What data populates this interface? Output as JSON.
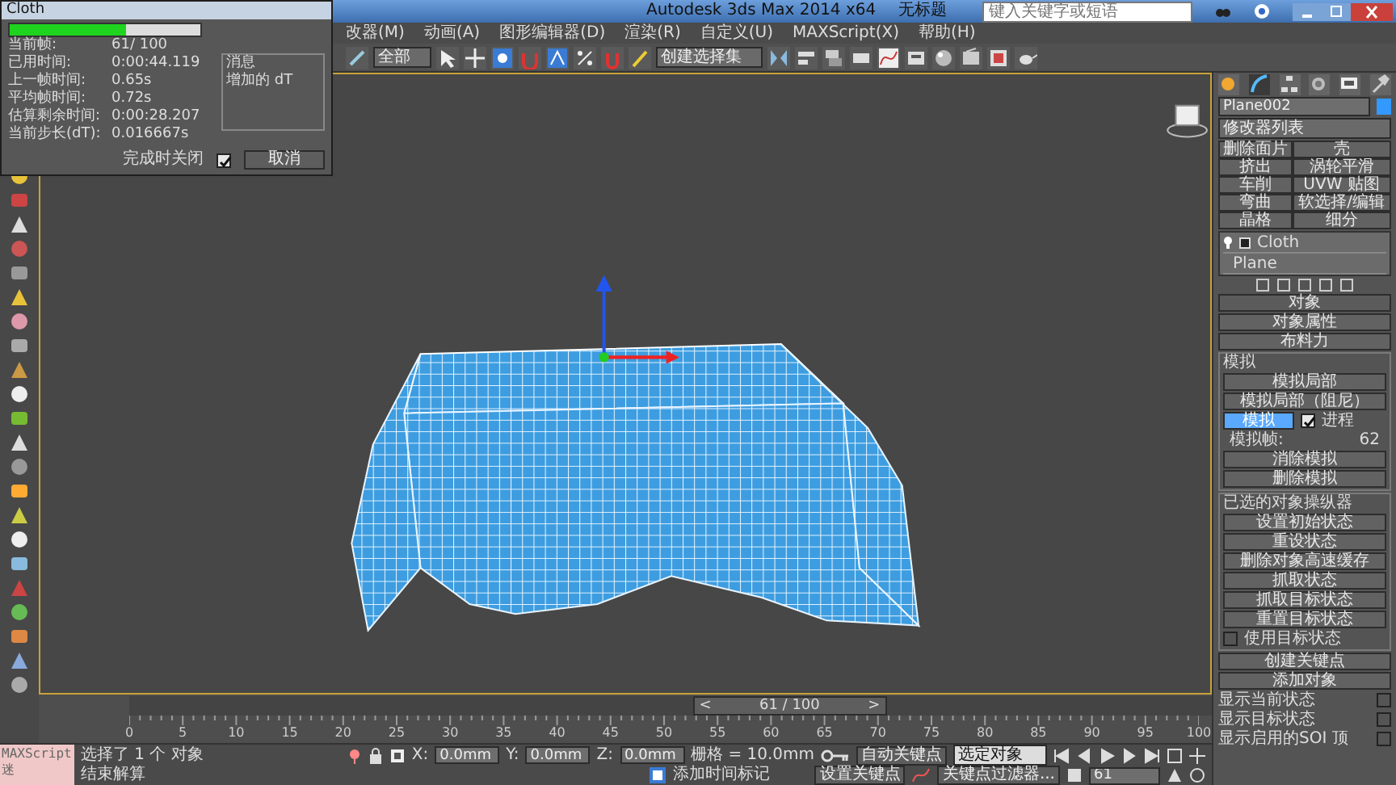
{
  "window": {
    "title": "Autodesk 3ds Max  2014 x64",
    "document": "无标题",
    "search_placeholder": "键入关键字或短语"
  },
  "menu": [
    "改器(M)",
    "动画(A)",
    "图形编辑器(D)",
    "渲染(R)",
    "自定义(U)",
    "MAXScript(X)",
    "帮助(H)"
  ],
  "toolbar": {
    "selection_filter": "全部",
    "named_selection": "创建选择集"
  },
  "cloth_dialog": {
    "title": "Cloth",
    "level": 0.61,
    "stats": [
      {
        "label": "当前帧:",
        "value": "61/ 100"
      },
      {
        "label": "已用时间:",
        "value": "0:00:44.119"
      },
      {
        "label": "上一帧时间:",
        "value": "0.65s"
      },
      {
        "label": "平均帧时间:",
        "value": "0.72s"
      },
      {
        "label": "估算剩余时间:",
        "value": "0:00:28.207"
      },
      {
        "label": "当前步长(dT):",
        "value": "0.016667s"
      }
    ],
    "messages": {
      "title": "消息",
      "text": "增加的 dT"
    },
    "close_on_finish": {
      "label": "完成时关闭",
      "checked": true
    },
    "cancel": "取消"
  },
  "command_panel": {
    "tabs": [
      {
        "kind": "create",
        "selected": false
      },
      {
        "kind": "modify",
        "selected": true
      },
      {
        "kind": "hierarchy",
        "selected": false
      },
      {
        "kind": "motion",
        "selected": false
      },
      {
        "kind": "display",
        "selected": false
      },
      {
        "kind": "utilities",
        "selected": false
      }
    ],
    "object_name": "Plane002",
    "modifier_list": "修改器列表",
    "modifier_buttons": [
      "删除面片",
      "壳",
      "挤出",
      "涡轮平滑",
      "车削",
      "UVW 贴图",
      "弯曲",
      "软选择/编辑",
      "晶格",
      "细分"
    ],
    "stack": [
      {
        "label": "Cloth"
      },
      {
        "label": "Plane"
      }
    ],
    "rollout": {
      "title": "对象",
      "buttons": [
        "对象属性",
        "布料力"
      ],
      "simulation": {
        "title": "模拟",
        "items": [
          {
            "kind": "button",
            "label": "模拟局部"
          },
          {
            "kind": "button",
            "label": "模拟局部（阻尼）"
          },
          {
            "kind": "toggle",
            "label": "模拟",
            "selected": true,
            "check_label": "进程",
            "checked": true
          },
          {
            "kind": "readout",
            "label": "模拟帧:",
            "value": "62"
          },
          {
            "kind": "button",
            "label": "消除模拟"
          },
          {
            "kind": "button",
            "label": "删除模拟"
          }
        ]
      },
      "manipulators": {
        "title": "已选的对象操纵器",
        "buttons": [
          "设置初始状态",
          "重设状态",
          "删除对象高速缓存",
          "抓取状态",
          "抓取目标状态",
          "重置目标状态"
        ],
        "checkbox": {
          "label": "使用目标状态",
          "checked": false
        }
      },
      "buttons2": [
        "创建关键点",
        "添加对象"
      ],
      "display": [
        {
          "label": "显示当前状态",
          "checked": false
        },
        {
          "label": "显示目标状态",
          "checked": false
        },
        {
          "label": "显示启用的SOI 顶",
          "checked": false
        }
      ]
    }
  },
  "timeline": {
    "prev": "<",
    "frame_label": "61 / 100",
    "next": ">",
    "level": 0.61,
    "ruler_labels": [
      "0",
      "5",
      "10",
      "15",
      "20",
      "25",
      "30",
      "35",
      "40",
      "45",
      "50",
      "55",
      "60",
      "65",
      "70",
      "75",
      "80",
      "85",
      "90",
      "95",
      "100"
    ]
  },
  "status_bar": {
    "script_label": "MAXScript 迷",
    "prompt": "选择了 1 个 对象",
    "hint": "结束解算",
    "coords": [
      {
        "axis": "X:",
        "value": "0.0mm"
      },
      {
        "axis": "Y:",
        "value": "0.0mm"
      },
      {
        "axis": "Z:",
        "value": "0.0mm"
      }
    ],
    "grid": "栅格 = 10.0mm",
    "time_tag": "添加时间标记",
    "auto_key": "自动关键点",
    "key_mode": "选定对象",
    "set_key": "设置关键点",
    "key_filters": "关键点过滤器...",
    "current_frame": "61"
  }
}
